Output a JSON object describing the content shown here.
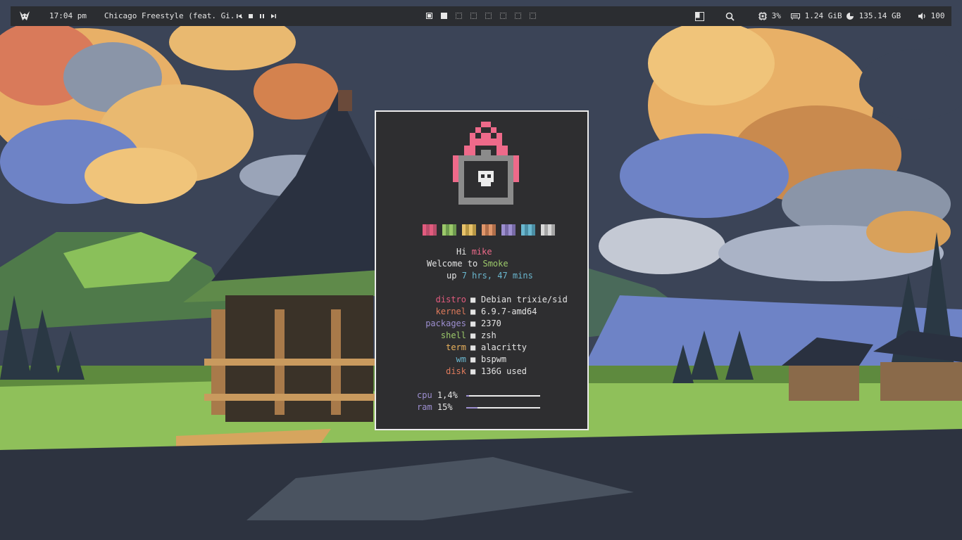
{
  "topbar": {
    "clock": "17:04 pm",
    "now_playing": "Chicago Freestyle (feat. Gi...",
    "cpu": "3%",
    "memory": "1.24 GiB",
    "disk": "135.14 GB",
    "volume": "100"
  },
  "fetch": {
    "greet_prefix": "Hi",
    "user": "mike",
    "welcome_prefix": "Welcome to",
    "host": "Smoke",
    "up_prefix": "up",
    "uptime": "7 hrs, 47 mins",
    "sep": "■",
    "rows": [
      {
        "key": "distro",
        "value": "Debian trixie/sid",
        "color": "#e25b7e"
      },
      {
        "key": "kernel",
        "value": "6.9.7-amd64",
        "color": "#e07b5c"
      },
      {
        "key": "packages",
        "value": "2370",
        "color": "#9d8fd0"
      },
      {
        "key": "shell",
        "value": "zsh",
        "color": "#9cc96a"
      },
      {
        "key": "term",
        "value": "alacritty",
        "color": "#e8b15c"
      },
      {
        "key": "wm",
        "value": "bspwm",
        "color": "#6ab7cf"
      },
      {
        "key": "disk",
        "value": "136G used",
        "color": "#e07b5c"
      }
    ],
    "cpu_label": "cpu",
    "cpu_value": "1,4%",
    "cpu_fraction": 0.014,
    "ram_label": "ram",
    "ram_value": "15%",
    "ram_fraction": 0.15,
    "palette": [
      [
        "#e25b7e",
        "#b84d6a"
      ],
      [
        "#9cc96a",
        "#6e9a4e"
      ],
      [
        "#e8c36a",
        "#b79644"
      ],
      [
        "#e0966a",
        "#b06e4a"
      ],
      [
        "#9d8fd0",
        "#776aa6"
      ],
      [
        "#6ab7cf",
        "#4b8ea4"
      ],
      [
        "#d8d8d8",
        "#a6a6a6"
      ]
    ]
  },
  "colors": {
    "accent_pink": "#ee6a8a",
    "green": "#9cc96a",
    "cyan": "#6ab7cf",
    "bar_bg": "#2b2d31",
    "term_bg": "#2e2e30"
  }
}
